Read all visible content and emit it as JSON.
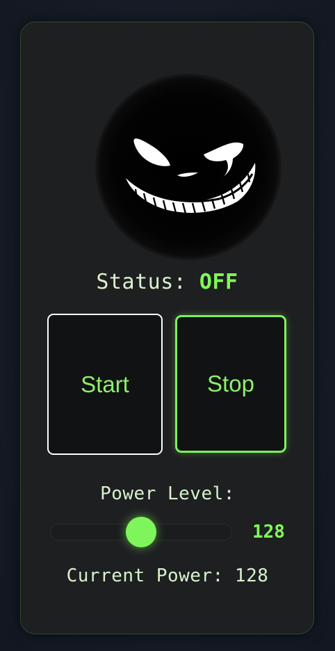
{
  "status": {
    "label": "Status:",
    "value": "OFF"
  },
  "buttons": {
    "start_label": "Start",
    "stop_label": "Stop"
  },
  "power": {
    "label": "Power Level:",
    "min": 0,
    "max": 255,
    "value": 128,
    "value_text": "128",
    "current_label": "Current Power:",
    "current_value": "128"
  },
  "colors": {
    "accent": "#7fff55",
    "text": "#d9f2cf",
    "card": "#1e1f21",
    "button_bg": "#111213"
  },
  "face": {
    "icon": "grinning-shadow-face-icon"
  }
}
